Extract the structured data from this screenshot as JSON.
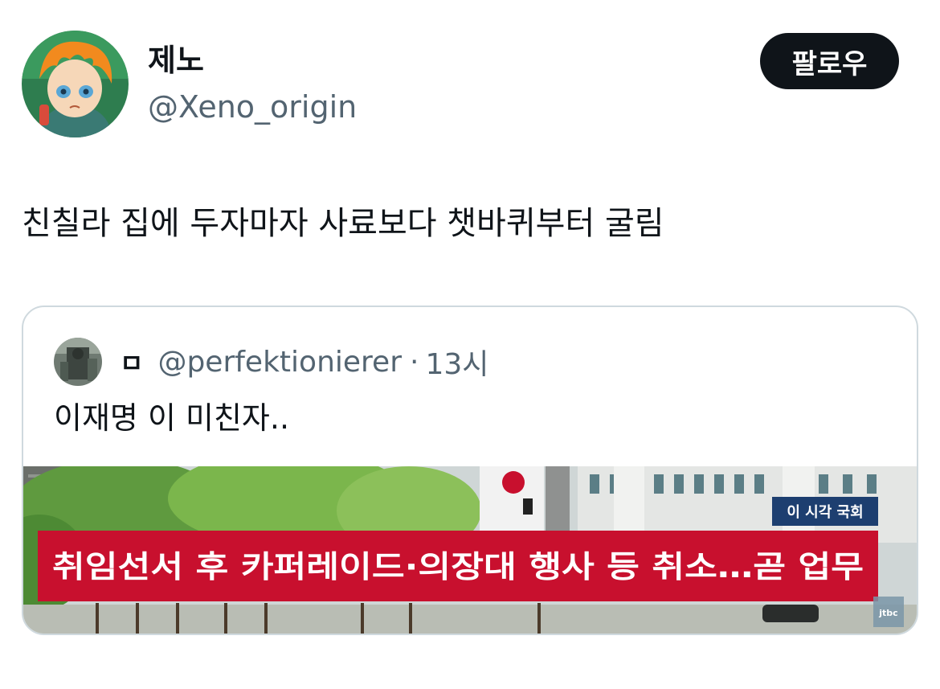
{
  "tweet": {
    "author_name": "제노",
    "author_handle": "@Xeno_origin",
    "follow_label": "팔로우",
    "text": "친칠라 집에 두자마자 사료보다 챗바퀴부터 굴림"
  },
  "quote": {
    "author_name": "ㅁ",
    "author_handle": "@perfektionierer",
    "separator": "·",
    "time": "13시",
    "text": "이재명 이 미친자..",
    "media": {
      "location_tag": "이 시각 국회",
      "headline": "취임선서 후 카퍼레이드·의장대 행사 등 취소…곧 업무",
      "broadcaster": "jtbc"
    }
  },
  "colors": {
    "text_primary": "#0f1419",
    "text_secondary": "#536471",
    "border": "#cfd9de",
    "follow_bg": "#0f1419",
    "news_banner": "#c8102e"
  }
}
